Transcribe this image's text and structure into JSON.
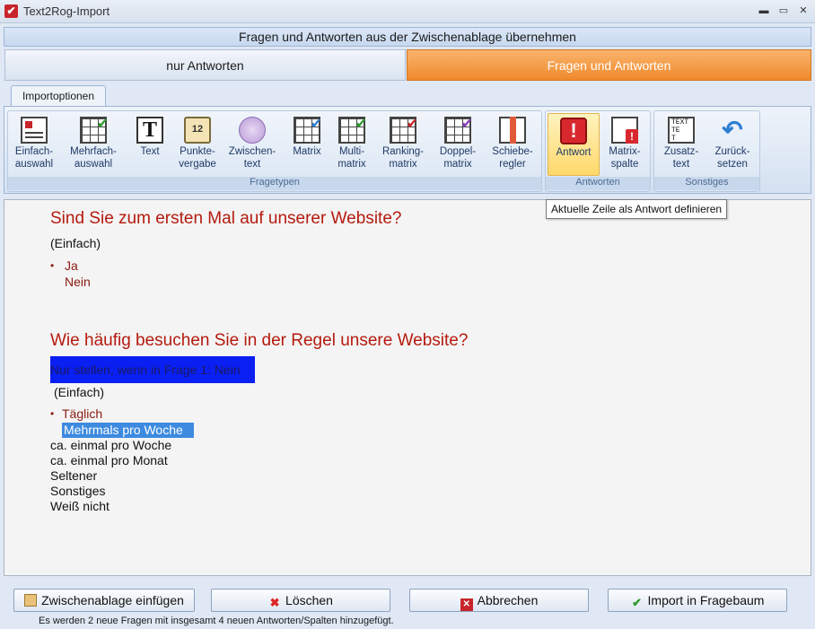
{
  "window": {
    "title": "Text2Rog-Import",
    "minimize": "▬",
    "maximize": "▭",
    "close": "✕"
  },
  "banner": "Fragen und Antworten aus der Zwischenablage übernehmen",
  "mode": {
    "left": "nur Antworten",
    "right": "Fragen und Antworten"
  },
  "ribbon": {
    "tab": "Importoptionen",
    "groups": {
      "fragetypen": {
        "label": "Fragetypen",
        "buttons": [
          {
            "line1": "Einfach-",
            "line2": "auswahl"
          },
          {
            "line1": "Mehrfach-",
            "line2": "auswahl"
          },
          {
            "line1": "Text",
            "line2": ""
          },
          {
            "line1": "Punkte-",
            "line2": "vergabe"
          },
          {
            "line1": "Zwischen-",
            "line2": "text"
          },
          {
            "line1": "Matrix",
            "line2": ""
          },
          {
            "line1": "Multi-",
            "line2": "matrix"
          },
          {
            "line1": "Ranking-",
            "line2": "matrix"
          },
          {
            "line1": "Doppel-",
            "line2": "matrix"
          },
          {
            "line1": "Schiebe-",
            "line2": "regler"
          }
        ]
      },
      "antworten": {
        "label": "Antworten",
        "buttons": [
          {
            "line1": "Antwort",
            "line2": ""
          },
          {
            "line1": "Matrix-",
            "line2": "spalte"
          }
        ]
      },
      "sonstiges": {
        "label": "Sonstiges",
        "buttons": [
          {
            "line1": "Zusatz-",
            "line2": "text"
          },
          {
            "line1": "Zurück-",
            "line2": "setzen"
          }
        ]
      }
    },
    "icon_text": {
      "T": "T",
      "punkte": "12",
      "excl": "!",
      "zusatz": "TEXT\nTE\nT"
    }
  },
  "tooltip": "Aktuelle Zeile als Antwort definieren",
  "content": {
    "q1": "Sind Sie zum ersten Mal auf unserer Website?",
    "q1_type": "(Einfach)",
    "q1_answers": [
      "Ja",
      "Nein"
    ],
    "q2": "Wie häufig besuchen Sie in der Regel unsere Website?",
    "q2_condition": "Nur stellen, wenn in Frage 1: Nein",
    "q2_type": "(Einfach)",
    "q2_answers": [
      "Täglich",
      "Mehrmals pro Woche",
      "ca. einmal pro Woche",
      "ca. einmal pro Monat",
      "Seltener",
      "Sonstiges",
      "Weiß nicht"
    ],
    "bullet": "•"
  },
  "buttons": {
    "paste": "Zwischenablage einfügen",
    "delete": "Löschen",
    "cancel": "Abbrechen",
    "import": "Import in Fragebaum"
  },
  "status": "Es werden 2 neue Fragen mit insgesamt 4 neuen Antworten/Spalten hinzugefügt.",
  "colors": {
    "question": "#b51a0e",
    "accent_orange": "#f08a2c",
    "selection_blue": "#0a1ff2"
  }
}
